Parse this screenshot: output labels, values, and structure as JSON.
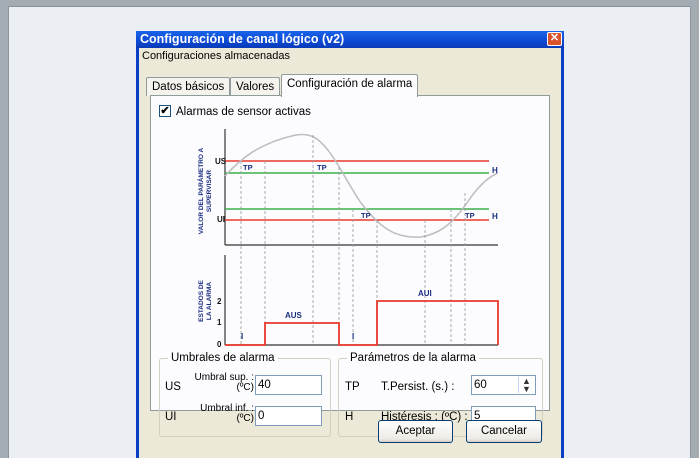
{
  "window": {
    "title": "Configuración de canal lógico (v2)",
    "close_glyph": "✕",
    "menu": "Configuraciones almacenadas"
  },
  "tabs": [
    "Datos básicos",
    "Valores",
    "Configuración de alarma"
  ],
  "alarm_checkbox": {
    "label": "Alarmas de sensor activas",
    "checked": true,
    "mark": "✔"
  },
  "diagram": {
    "ylabel_top_line1": "VALOR DEL PARÁMETRO A",
    "ylabel_top_line2": "SUPERVISAR",
    "ylabel_bottom_line1": "ESTADOS DE",
    "ylabel_bottom_line2": "LA ALARMA",
    "us": "US",
    "ui": "UI",
    "h": "H",
    "tp": "TP",
    "tick_2": "2",
    "tick_1": "1",
    "tick_0": "0",
    "aus": "AUS",
    "aui": "AUI",
    "idle": "I",
    "colors": {
      "threshold": "#e8392b",
      "hysteresis": "#3bb04a",
      "curve": "#bdbdbd",
      "state": "#e8392b"
    }
  },
  "umbrales": {
    "title": "Umbrales de alarma",
    "us_label": "US",
    "sup_line1": "Umbral sup. :",
    "sup_line2": "(ºC)",
    "sup_value": "40",
    "ui_label": "UI",
    "inf_line1": "Umbral inf. :",
    "inf_line2": "(ºC)",
    "inf_value": "0"
  },
  "parametros": {
    "title": "Parámetros de la alarma",
    "tp_label": "TP",
    "persist_label": "T.Persist. (s.) :",
    "persist_value": "60",
    "h_label": "H",
    "hist_label": "Histéresis : (ºC) :",
    "hist_value": "5"
  },
  "buttons": {
    "ok": "Aceptar",
    "cancel": "Cancelar"
  }
}
